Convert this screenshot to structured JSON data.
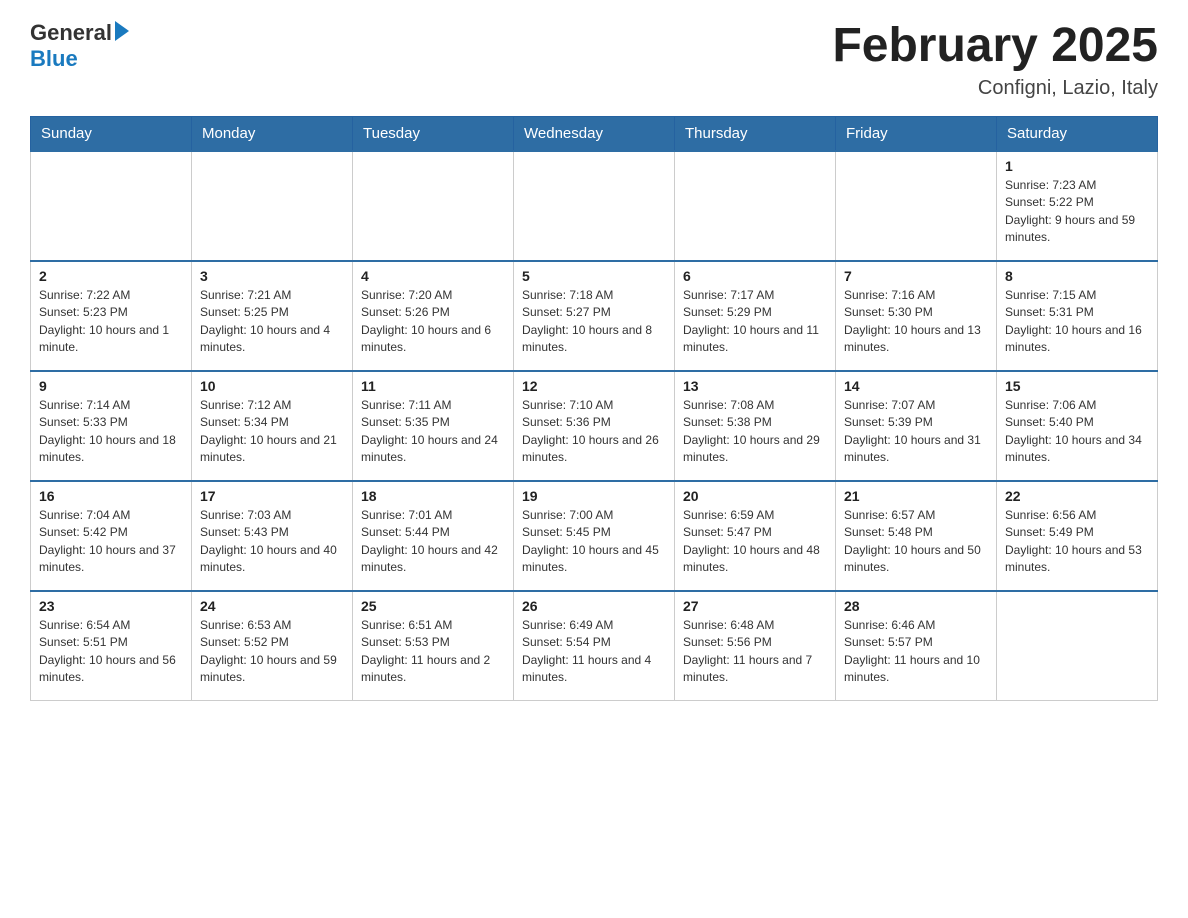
{
  "logo": {
    "general": "General",
    "blue": "Blue"
  },
  "title": "February 2025",
  "location": "Configni, Lazio, Italy",
  "days_of_week": [
    "Sunday",
    "Monday",
    "Tuesday",
    "Wednesday",
    "Thursday",
    "Friday",
    "Saturday"
  ],
  "weeks": [
    [
      {
        "day": "",
        "info": ""
      },
      {
        "day": "",
        "info": ""
      },
      {
        "day": "",
        "info": ""
      },
      {
        "day": "",
        "info": ""
      },
      {
        "day": "",
        "info": ""
      },
      {
        "day": "",
        "info": ""
      },
      {
        "day": "1",
        "info": "Sunrise: 7:23 AM\nSunset: 5:22 PM\nDaylight: 9 hours and 59 minutes."
      }
    ],
    [
      {
        "day": "2",
        "info": "Sunrise: 7:22 AM\nSunset: 5:23 PM\nDaylight: 10 hours and 1 minute."
      },
      {
        "day": "3",
        "info": "Sunrise: 7:21 AM\nSunset: 5:25 PM\nDaylight: 10 hours and 4 minutes."
      },
      {
        "day": "4",
        "info": "Sunrise: 7:20 AM\nSunset: 5:26 PM\nDaylight: 10 hours and 6 minutes."
      },
      {
        "day": "5",
        "info": "Sunrise: 7:18 AM\nSunset: 5:27 PM\nDaylight: 10 hours and 8 minutes."
      },
      {
        "day": "6",
        "info": "Sunrise: 7:17 AM\nSunset: 5:29 PM\nDaylight: 10 hours and 11 minutes."
      },
      {
        "day": "7",
        "info": "Sunrise: 7:16 AM\nSunset: 5:30 PM\nDaylight: 10 hours and 13 minutes."
      },
      {
        "day": "8",
        "info": "Sunrise: 7:15 AM\nSunset: 5:31 PM\nDaylight: 10 hours and 16 minutes."
      }
    ],
    [
      {
        "day": "9",
        "info": "Sunrise: 7:14 AM\nSunset: 5:33 PM\nDaylight: 10 hours and 18 minutes."
      },
      {
        "day": "10",
        "info": "Sunrise: 7:12 AM\nSunset: 5:34 PM\nDaylight: 10 hours and 21 minutes."
      },
      {
        "day": "11",
        "info": "Sunrise: 7:11 AM\nSunset: 5:35 PM\nDaylight: 10 hours and 24 minutes."
      },
      {
        "day": "12",
        "info": "Sunrise: 7:10 AM\nSunset: 5:36 PM\nDaylight: 10 hours and 26 minutes."
      },
      {
        "day": "13",
        "info": "Sunrise: 7:08 AM\nSunset: 5:38 PM\nDaylight: 10 hours and 29 minutes."
      },
      {
        "day": "14",
        "info": "Sunrise: 7:07 AM\nSunset: 5:39 PM\nDaylight: 10 hours and 31 minutes."
      },
      {
        "day": "15",
        "info": "Sunrise: 7:06 AM\nSunset: 5:40 PM\nDaylight: 10 hours and 34 minutes."
      }
    ],
    [
      {
        "day": "16",
        "info": "Sunrise: 7:04 AM\nSunset: 5:42 PM\nDaylight: 10 hours and 37 minutes."
      },
      {
        "day": "17",
        "info": "Sunrise: 7:03 AM\nSunset: 5:43 PM\nDaylight: 10 hours and 40 minutes."
      },
      {
        "day": "18",
        "info": "Sunrise: 7:01 AM\nSunset: 5:44 PM\nDaylight: 10 hours and 42 minutes."
      },
      {
        "day": "19",
        "info": "Sunrise: 7:00 AM\nSunset: 5:45 PM\nDaylight: 10 hours and 45 minutes."
      },
      {
        "day": "20",
        "info": "Sunrise: 6:59 AM\nSunset: 5:47 PM\nDaylight: 10 hours and 48 minutes."
      },
      {
        "day": "21",
        "info": "Sunrise: 6:57 AM\nSunset: 5:48 PM\nDaylight: 10 hours and 50 minutes."
      },
      {
        "day": "22",
        "info": "Sunrise: 6:56 AM\nSunset: 5:49 PM\nDaylight: 10 hours and 53 minutes."
      }
    ],
    [
      {
        "day": "23",
        "info": "Sunrise: 6:54 AM\nSunset: 5:51 PM\nDaylight: 10 hours and 56 minutes."
      },
      {
        "day": "24",
        "info": "Sunrise: 6:53 AM\nSunset: 5:52 PM\nDaylight: 10 hours and 59 minutes."
      },
      {
        "day": "25",
        "info": "Sunrise: 6:51 AM\nSunset: 5:53 PM\nDaylight: 11 hours and 2 minutes."
      },
      {
        "day": "26",
        "info": "Sunrise: 6:49 AM\nSunset: 5:54 PM\nDaylight: 11 hours and 4 minutes."
      },
      {
        "day": "27",
        "info": "Sunrise: 6:48 AM\nSunset: 5:56 PM\nDaylight: 11 hours and 7 minutes."
      },
      {
        "day": "28",
        "info": "Sunrise: 6:46 AM\nSunset: 5:57 PM\nDaylight: 11 hours and 10 minutes."
      },
      {
        "day": "",
        "info": ""
      }
    ]
  ]
}
